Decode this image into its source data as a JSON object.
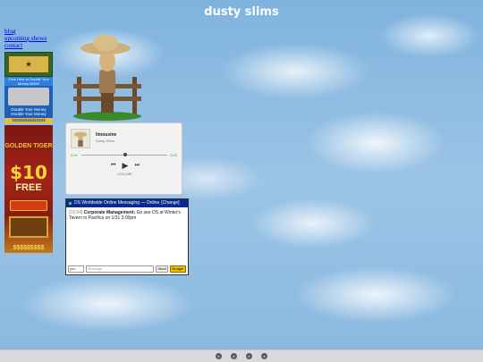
{
  "site": {
    "title": "dusty slims"
  },
  "nav": {
    "items": [
      "blog",
      "upcoming shows",
      "contact"
    ]
  },
  "player": {
    "track": "limousine",
    "artist": "Dusty Slims",
    "time_elapsed": "0:00",
    "time_total": "0:00",
    "volume_label": "VOLUME"
  },
  "chat": {
    "header_title": "DS Worldwide Online Messaging — Online",
    "change_label": "[Change]",
    "message": {
      "time": "[18:54]",
      "sender": "Corporate Management:",
      "text": "Go see DS at Winter's Tavern in Pacifica on 1/31 3:00pm"
    },
    "nick_value": "you",
    "message_placeholder": "Message",
    "send_label": "Send",
    "nudge_label": "Nudge!"
  },
  "ads": {
    "money": {
      "top": "Click Here to Double Your Money NOW!",
      "line1": "Double Your Money",
      "line2": "Double Your Money",
      "dollars": "$$$$$$$$$$$$$$$"
    },
    "tiger": {
      "name": "GOLDEN TIGER",
      "amount": "$10",
      "free": "FREE",
      "dollars": "$$$$$$$$$"
    }
  },
  "footer": {
    "icons": [
      "spotify-icon",
      "apple-icon",
      "soundcloud-icon",
      "instagram-icon"
    ]
  },
  "colors": {
    "sky": "#8fbde4",
    "link": "#0000ee",
    "chat_header": "#0a2a8f"
  }
}
